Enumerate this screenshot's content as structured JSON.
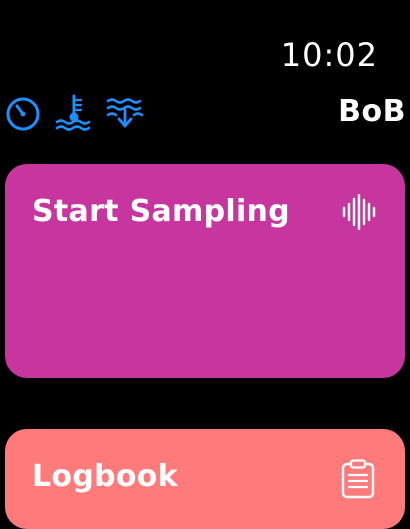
{
  "clock": {
    "time": "10:02"
  },
  "header": {
    "app_name": "BoB",
    "icons": [
      "timer-icon",
      "water-temperature-icon",
      "water-depth-icon"
    ]
  },
  "cards": [
    {
      "title": "Start Sampling",
      "icon": "waveform-icon",
      "color": "#C7369F"
    },
    {
      "title": "Logbook",
      "icon": "clipboard-icon",
      "color": "#FF7B7B"
    }
  ],
  "colors": {
    "background": "#000000",
    "accent_blue": "#1E8FFF",
    "text": "#FFFFFF"
  }
}
